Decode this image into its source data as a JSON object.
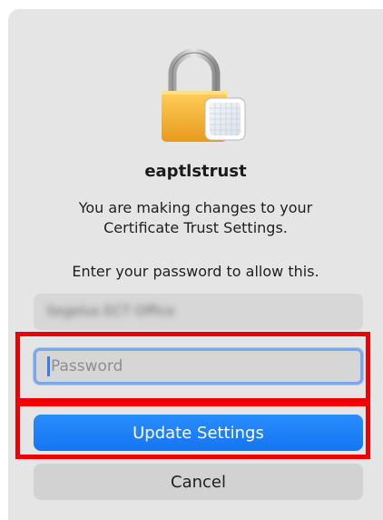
{
  "dialog": {
    "app_name": "eaptlstrust",
    "message_line1": "You are making changes to your",
    "message_line2": "Certificate Trust Settings.",
    "prompt": "Enter your password to allow this."
  },
  "username_field": {
    "value": "Segelus ECT Office"
  },
  "password_field": {
    "placeholder": "Password",
    "value": ""
  },
  "buttons": {
    "update_label": "Update Settings",
    "cancel_label": "Cancel"
  },
  "icons": {
    "lock": "padlock-icon"
  },
  "colors": {
    "accent": "#1a7ef5",
    "highlight": "#f00000",
    "focus_ring": "#7ea6ea"
  }
}
